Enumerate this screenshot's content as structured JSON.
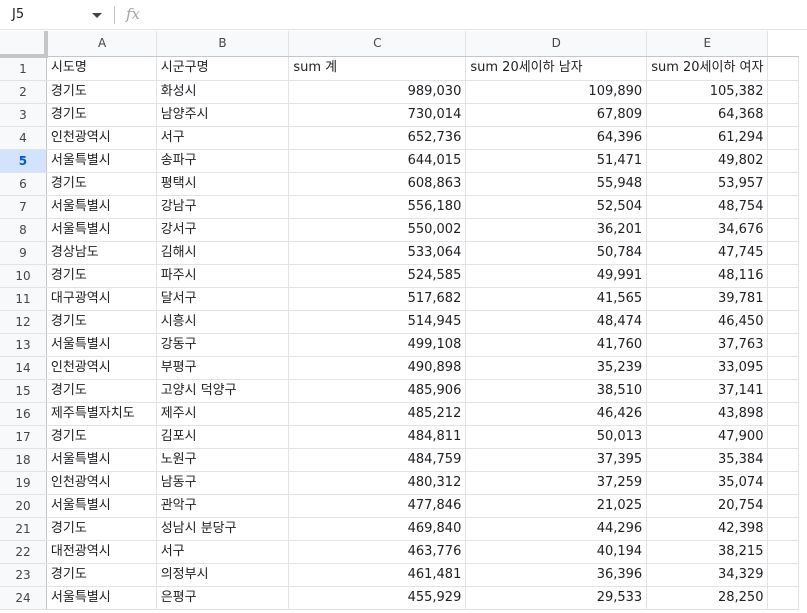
{
  "formula_bar": {
    "name_box": "J5",
    "fx_label": "fx"
  },
  "sheet": {
    "selected_row": "5",
    "columns": [
      "A",
      "B",
      "C",
      "D",
      "E"
    ],
    "rows": [
      {
        "num": "1",
        "cells": [
          "시도명",
          "시군구명",
          "sum 계",
          "sum 20세이하 남자",
          "sum 20세이하 여자"
        ]
      },
      {
        "num": "2",
        "cells": [
          "경기도",
          "화성시",
          "989,030",
          "109,890",
          "105,382"
        ]
      },
      {
        "num": "3",
        "cells": [
          "경기도",
          "남양주시",
          "730,014",
          "67,809",
          "64,368"
        ]
      },
      {
        "num": "4",
        "cells": [
          "인천광역시",
          "서구",
          "652,736",
          "64,396",
          "61,294"
        ]
      },
      {
        "num": "5",
        "cells": [
          "서울특별시",
          "송파구",
          "644,015",
          "51,471",
          "49,802"
        ]
      },
      {
        "num": "6",
        "cells": [
          "경기도",
          "평택시",
          "608,863",
          "55,948",
          "53,957"
        ]
      },
      {
        "num": "7",
        "cells": [
          "서울특별시",
          "강남구",
          "556,180",
          "52,504",
          "48,754"
        ]
      },
      {
        "num": "8",
        "cells": [
          "서울특별시",
          "강서구",
          "550,002",
          "36,201",
          "34,676"
        ]
      },
      {
        "num": "9",
        "cells": [
          "경상남도",
          "김해시",
          "533,064",
          "50,784",
          "47,745"
        ]
      },
      {
        "num": "10",
        "cells": [
          "경기도",
          "파주시",
          "524,585",
          "49,991",
          "48,116"
        ]
      },
      {
        "num": "11",
        "cells": [
          "대구광역시",
          "달서구",
          "517,682",
          "41,565",
          "39,781"
        ]
      },
      {
        "num": "12",
        "cells": [
          "경기도",
          "시흥시",
          "514,945",
          "48,474",
          "46,450"
        ]
      },
      {
        "num": "13",
        "cells": [
          "서울특별시",
          "강동구",
          "499,108",
          "41,760",
          "37,763"
        ]
      },
      {
        "num": "14",
        "cells": [
          "인천광역시",
          "부평구",
          "490,898",
          "35,239",
          "33,095"
        ]
      },
      {
        "num": "15",
        "cells": [
          "경기도",
          "고양시 덕양구",
          "485,906",
          "38,510",
          "37,141"
        ]
      },
      {
        "num": "16",
        "cells": [
          "제주특별자치도",
          "제주시",
          "485,212",
          "46,426",
          "43,898"
        ]
      },
      {
        "num": "17",
        "cells": [
          "경기도",
          "김포시",
          "484,811",
          "50,013",
          "47,900"
        ]
      },
      {
        "num": "18",
        "cells": [
          "서울특별시",
          "노원구",
          "484,759",
          "37,395",
          "35,384"
        ]
      },
      {
        "num": "19",
        "cells": [
          "인천광역시",
          "남동구",
          "480,312",
          "37,259",
          "35,074"
        ]
      },
      {
        "num": "20",
        "cells": [
          "서울특별시",
          "관악구",
          "477,846",
          "21,025",
          "20,754"
        ]
      },
      {
        "num": "21",
        "cells": [
          "경기도",
          "성남시 분당구",
          "469,840",
          "44,296",
          "42,398"
        ]
      },
      {
        "num": "22",
        "cells": [
          "대전광역시",
          "서구",
          "463,776",
          "40,194",
          "38,215"
        ]
      },
      {
        "num": "23",
        "cells": [
          "경기도",
          "의정부시",
          "461,481",
          "36,396",
          "34,329"
        ]
      },
      {
        "num": "24",
        "cells": [
          "서울특별시",
          "은평구",
          "455,929",
          "29,533",
          "28,250"
        ]
      }
    ]
  }
}
